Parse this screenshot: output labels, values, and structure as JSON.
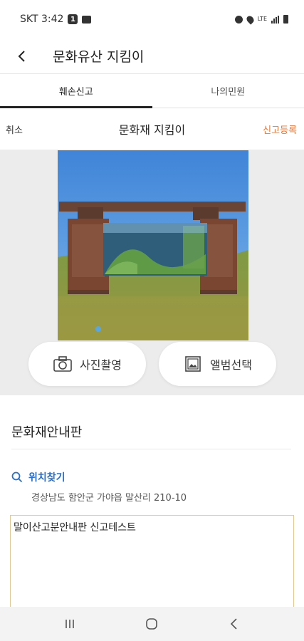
{
  "status_bar": {
    "carrier_time": "SKT 3:42",
    "notification_count": "1",
    "lte_label": "LTE"
  },
  "header": {
    "title": "문화유산 지킴이",
    "back_icon": "chevron-left-icon"
  },
  "tabs": [
    {
      "label": "훼손신고",
      "active": true
    },
    {
      "label": "나의민원",
      "active": false
    }
  ],
  "action_bar": {
    "cancel_label": "취소",
    "title": "문화재 지킴이",
    "register_label": "신고등록",
    "register_color": "#e07a3c"
  },
  "photo_buttons": {
    "camera_label": "사진촬영",
    "camera_icon": "camera-icon",
    "album_label": "앨범선택",
    "album_icon": "image-icon"
  },
  "form": {
    "section_title": "문화재안내판",
    "location_label": "위치찾기",
    "location_icon": "search-icon",
    "location_color": "#2a6fc9",
    "address": "경상남도 함안군 가야읍 말산리 210-10",
    "report_text": "말이산고분안내판 신고테스트"
  },
  "nav_bar": {
    "recents_icon": "recents-icon",
    "home_icon": "home-icon",
    "back_icon": "back-icon"
  }
}
